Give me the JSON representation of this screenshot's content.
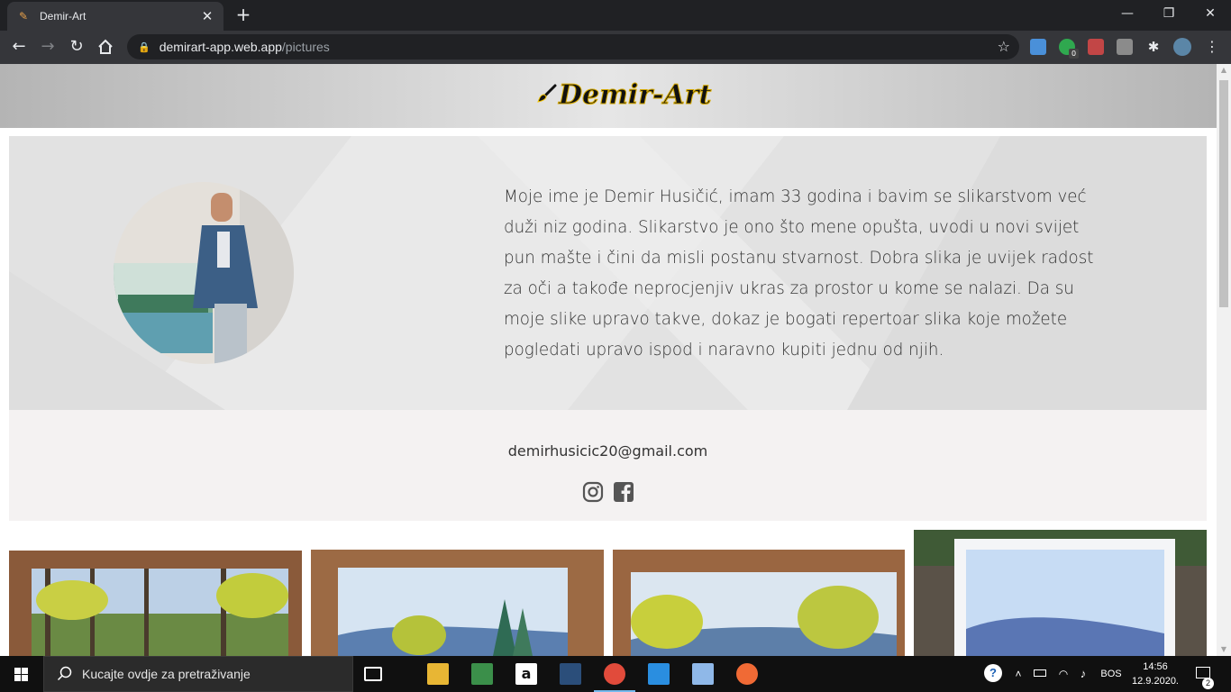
{
  "browser": {
    "tab_title": "Demir-Art",
    "url_host": "demirart-app.web.app",
    "url_path": "/pictures"
  },
  "site": {
    "logo_text": "Demir-Art",
    "bio": "Moje ime je Demir Husičić, imam 33 godina i bavim se slikarstvom već duži niz godina. Slikarstvo je ono što mene opušta, uvodi u novi svijet pun mašte i čini da misli postanu stvarnost. Dobra slika je uvijek radost za oči a takođe neprocjenjiv ukras za prostor u kome se nalazi. Da su moje slike upravo takve, dokaz je bogati repertoar slika koje možete pogledati upravo ispod i naravno kupiti jednu od njih.",
    "email": "demirhusicic20@gmail.com",
    "social": [
      "instagram-icon",
      "facebook-icon"
    ]
  },
  "taskbar": {
    "search_placeholder": "Kucajte ovdje za pretraživanje",
    "language": "BOS",
    "time": "14:56",
    "date": "12.9.2020.",
    "notification_count": "2",
    "download_badge": "0"
  },
  "colors": {
    "chrome_dark": "#202124",
    "chrome_toolbar": "#35363a",
    "hero_bg": "#e5e5e5",
    "contact_bg": "#f4f2f2",
    "logo_accent": "#f3c400"
  }
}
